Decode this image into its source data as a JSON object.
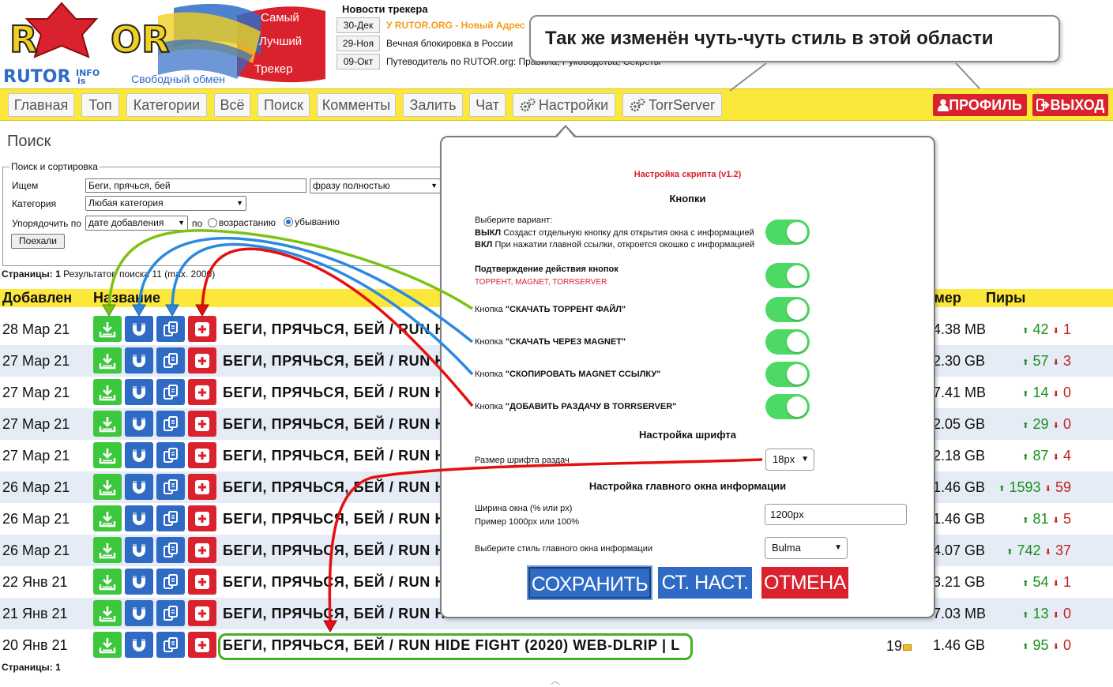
{
  "logo": {
    "letters_left": "R",
    "letters_right": "OR",
    "site": "RUTOR",
    "site_suffix": "INFO",
    "site_suffix2": "is",
    "tagline": "Свободный обмен",
    "ribbon1": "Самый",
    "ribbon2": "Лучший",
    "ribbon3": "Трекер"
  },
  "news": {
    "title": "Новости трекера",
    "items": [
      {
        "date": "30-Дек",
        "text": "У RUTOR.ORG - Новый Адрес"
      },
      {
        "date": "29-Ноя",
        "text": "Вечная блокировка в России"
      },
      {
        "date": "09-Окт",
        "text": "Путеводитель по RUTOR.org: Правила, Руководства, Секреты"
      }
    ]
  },
  "callout": "Так же изменён чуть-чуть стиль в этой области",
  "nav": {
    "items": [
      "Главная",
      "Топ",
      "Категории",
      "Всё",
      "Поиск",
      "Комменты",
      "Залить",
      "Чат",
      "Настройки",
      "TorrServer"
    ],
    "profile": "ПРОФИЛЬ",
    "logout": "ВЫХОД"
  },
  "page_title": "Поиск",
  "search": {
    "legend": "Поиск и сортировка",
    "query_label": "Ищем",
    "query_value": "Беги, прячься, бей",
    "mode_value": "фразу полностью",
    "category_label": "Категория",
    "category_value": "Любая категория",
    "sort_label": "Упорядочить по",
    "sort_value": "дате добавления",
    "by_label": "по",
    "asc_label": "возрастанию",
    "desc_label": "убыванию",
    "go_button": "Поехали"
  },
  "pages_top": {
    "label": "Страницы:",
    "page": "1",
    "results": "Результатов поиска 11 (max. 2000)"
  },
  "pages_bottom": "Страницы: 1",
  "table": {
    "headers": {
      "added": "Добавлен",
      "name": "Название",
      "size": "Размер",
      "peers": "Пиры"
    },
    "rows": [
      {
        "date": "28 Мар 21",
        "title": "БЕГИ, ПРЯЧЬСЯ, БЕЙ / RUN H",
        "size": "4.38 MB",
        "seeds": "42",
        "leech": "1"
      },
      {
        "date": "27 Мар 21",
        "title": "БЕГИ, ПРЯЧЬСЯ, БЕЙ / RUN H",
        "size": "2.30 GB",
        "seeds": "57",
        "leech": "3"
      },
      {
        "date": "27 Мар 21",
        "title": "БЕГИ, ПРЯЧЬСЯ, БЕЙ / RUN H",
        "size": "7.41 MB",
        "seeds": "14",
        "leech": "0"
      },
      {
        "date": "27 Мар 21",
        "title": "БЕГИ, ПРЯЧЬСЯ, БЕЙ / RUN H",
        "size": "2.05 GB",
        "seeds": "29",
        "leech": "0"
      },
      {
        "date": "27 Мар 21",
        "title": "БЕГИ, ПРЯЧЬСЯ, БЕЙ / RUN H",
        "size": "2.18 GB",
        "seeds": "87",
        "leech": "4"
      },
      {
        "date": "26 Мар 21",
        "title": "БЕГИ, ПРЯЧЬСЯ, БЕЙ / RUN H",
        "size": "1.46 GB",
        "seeds": "1593",
        "leech": "59"
      },
      {
        "date": "26 Мар 21",
        "title": "БЕГИ, ПРЯЧЬСЯ, БЕЙ / RUN H",
        "size": "1.46 GB",
        "seeds": "81",
        "leech": "5"
      },
      {
        "date": "26 Мар 21",
        "title": "БЕГИ, ПРЯЧЬСЯ, БЕЙ / RUN H",
        "size": "4.07 GB",
        "seeds": "742",
        "leech": "37"
      },
      {
        "date": "22 Янв 21",
        "title": "БЕГИ, ПРЯЧЬСЯ, БЕЙ / RUN H",
        "size": "3.21 GB",
        "seeds": "54",
        "leech": "1"
      },
      {
        "date": "21 Янв 21",
        "title": "БЕГИ, ПРЯЧЬСЯ, БЕЙ / RUN H",
        "size": "7.03 MB",
        "seeds": "13",
        "leech": "0"
      },
      {
        "date": "20 Янв 21",
        "title": "БЕГИ, ПРЯЧЬСЯ, БЕЙ / RUN HIDE FIGHT (2020) WEB-DLRIP | L",
        "size": "1.46 GB",
        "seeds": "95",
        "leech": "0",
        "comments": "19"
      }
    ]
  },
  "popup": {
    "title": "Настройка скрипта (v1.2)",
    "section_buttons": "Кнопки",
    "variant_label": "Выберите вариант:",
    "variant_off_key": "ВЫКЛ",
    "variant_off_text": "Создаст отдельную кнопку для открытия окна с информацией",
    "variant_on_key": "ВКЛ",
    "variant_on_text": "При нажатии главной ссылки, откроется окошко с информацией",
    "confirm_label": "Подтверждение действия кнопок",
    "confirm_sub": "ТОРРЕНТ, MAGNET, TORRSERVER",
    "btn_prefix": "Кнопка",
    "btn_torrent": "\"СКАЧАТЬ ТОРРЕНТ ФАЙЛ\"",
    "btn_magnet": "\"СКАЧАТЬ ЧЕРЕЗ MAGNET\"",
    "btn_copy": "\"СКОПИРОВАТЬ MAGNET ССЫЛКУ\"",
    "btn_torrserver": "\"ДОБАВИТЬ РАЗДАЧУ В TORRSERVER\"",
    "section_font": "Настройка шрифта",
    "font_size_label": "Размер шрифта раздач",
    "font_size_value": "18px",
    "section_window": "Настройка главного окна информации",
    "width_label": "Ширина окна (% или px)",
    "width_example": "Пример 1000px или 100%",
    "width_value": "1200px",
    "style_label": "Выберите стиль главного окна информации",
    "style_value": "Bulma",
    "save": "СОХРАНИТЬ",
    "defaults": "СТ. НАСТ.",
    "cancel": "ОТМЕНА"
  },
  "colors": {
    "nav_yellow": "#fce83a",
    "red": "#d9222e",
    "green": "#3cc73c",
    "blue": "#2f6bc5",
    "toggle_green": "#4cd964"
  }
}
